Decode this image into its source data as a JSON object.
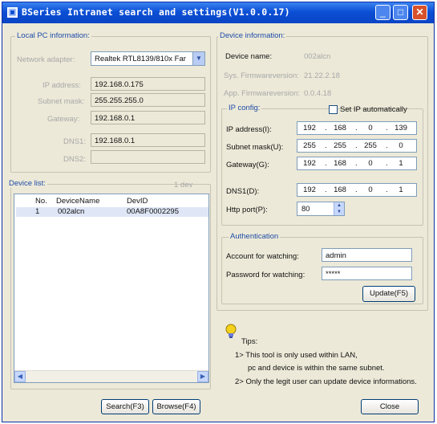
{
  "window": {
    "title": "BSeries Intranet search and settings(V1.0.0.17)",
    "min_symbol": "_",
    "max_symbol": "□",
    "close_symbol": "✕"
  },
  "local_pc": {
    "legend": "Local PC information:",
    "network_adapter_label": "Network adapter:",
    "network_adapter_value": "Realtek RTL8139/810x Far",
    "ip_label": "IP address:",
    "ip_value": "192.168.0.175",
    "subnet_label": "Subnet mask:",
    "subnet_value": "255.255.255.0",
    "gateway_label": "Gateway:",
    "gateway_value": "192.168.0.1",
    "dns1_label": "DNS1:",
    "dns1_value": "192.168.0.1",
    "dns2_label": "DNS2:",
    "dns2_value": ""
  },
  "device_list": {
    "legend": "Device list:",
    "count": "1 dev",
    "columns": [
      "No.",
      "DeviceName",
      "DevID"
    ],
    "rows": [
      {
        "no": "1",
        "name": "002alcn",
        "id": "00A8F0002295"
      }
    ]
  },
  "device_info": {
    "legend": "Device information:",
    "name_label": "Device name:",
    "name_value": "002alcn",
    "sys_fw_label": "Sys. Firmwareversion:",
    "sys_fw_value": "21.22.2.18",
    "app_fw_label": "App. Firmwareversion:",
    "app_fw_value": "0.0.4.18"
  },
  "ip_config": {
    "legend": "IP config:",
    "auto_label": "Set IP automatically",
    "ip_label": "IP address(I):",
    "ip": [
      "192",
      "168",
      "0",
      "139"
    ],
    "subnet_label": "Subnet mask(U):",
    "subnet": [
      "255",
      "255",
      "255",
      "0"
    ],
    "gateway_label": "Gateway(G):",
    "gateway": [
      "192",
      "168",
      "0",
      "1"
    ],
    "dns1_label": "DNS1(D):",
    "dns1": [
      "192",
      "168",
      "0",
      "1"
    ],
    "http_label": "Http port(P):",
    "http_value": "80"
  },
  "auth": {
    "legend": "Authentication",
    "account_label": "Account for watching:",
    "account_value": "admin",
    "password_label": "Password for watching:",
    "password_value": "*****",
    "update_button": "Update(F5)"
  },
  "tips": {
    "title": "Tips:",
    "line1": "1> This tool is only used within LAN,",
    "line2": "pc and device is within the same subnet.",
    "line3": "2> Only the legit user can update  device informations."
  },
  "buttons": {
    "search": "Search(F3)",
    "browse": "Browse(F4)",
    "close": "Close"
  },
  "icons": {
    "combo_arrow": "▼",
    "scroll_left": "◀",
    "scroll_right": "▶",
    "spin_up": "▲",
    "spin_down": "▼"
  }
}
